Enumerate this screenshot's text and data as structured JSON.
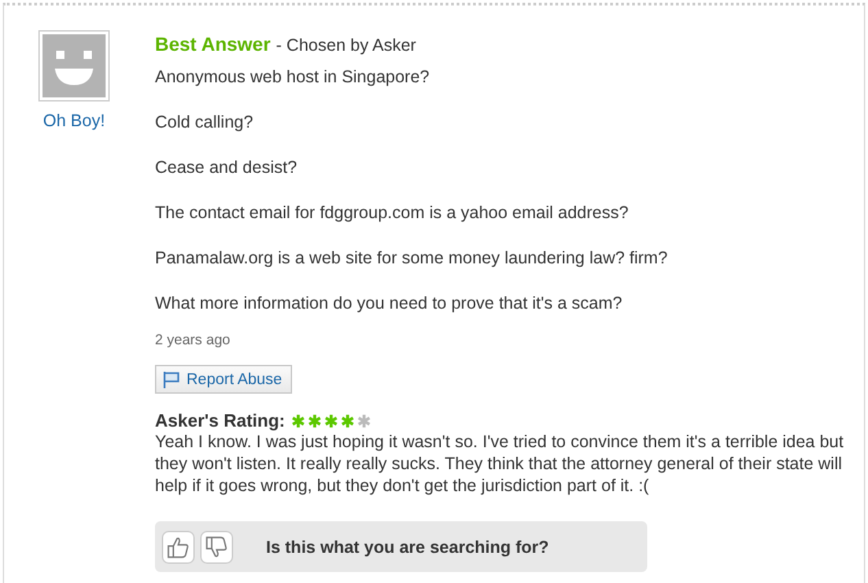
{
  "answer": {
    "user_name": "Oh Boy!",
    "badge": "Best Answer",
    "badge_suffix": "- Chosen by Asker",
    "paragraphs": [
      "Anonymous web host in Singapore?",
      "Cold calling?",
      "Cease and desist?",
      "The contact email for fdggroup.com is a yahoo email address?",
      "Panamalaw.org is a web site for some money laundering law? firm?",
      "What more information do you need to prove that it's a scam?"
    ],
    "time": "2 years ago",
    "report_button": "Report Abuse"
  },
  "rating": {
    "label": "Asker's Rating:",
    "stars": 4,
    "comment": "Yeah I know. I was just hoping it wasn't so. I've tried to convince them it's a terrible idea but they won't listen. It really really sucks. They think that the attorney general of their state will help if it goes wrong, but they don't get the jurisdiction part of it. :("
  },
  "feedback": {
    "question": "Is this what you are searching for?"
  }
}
